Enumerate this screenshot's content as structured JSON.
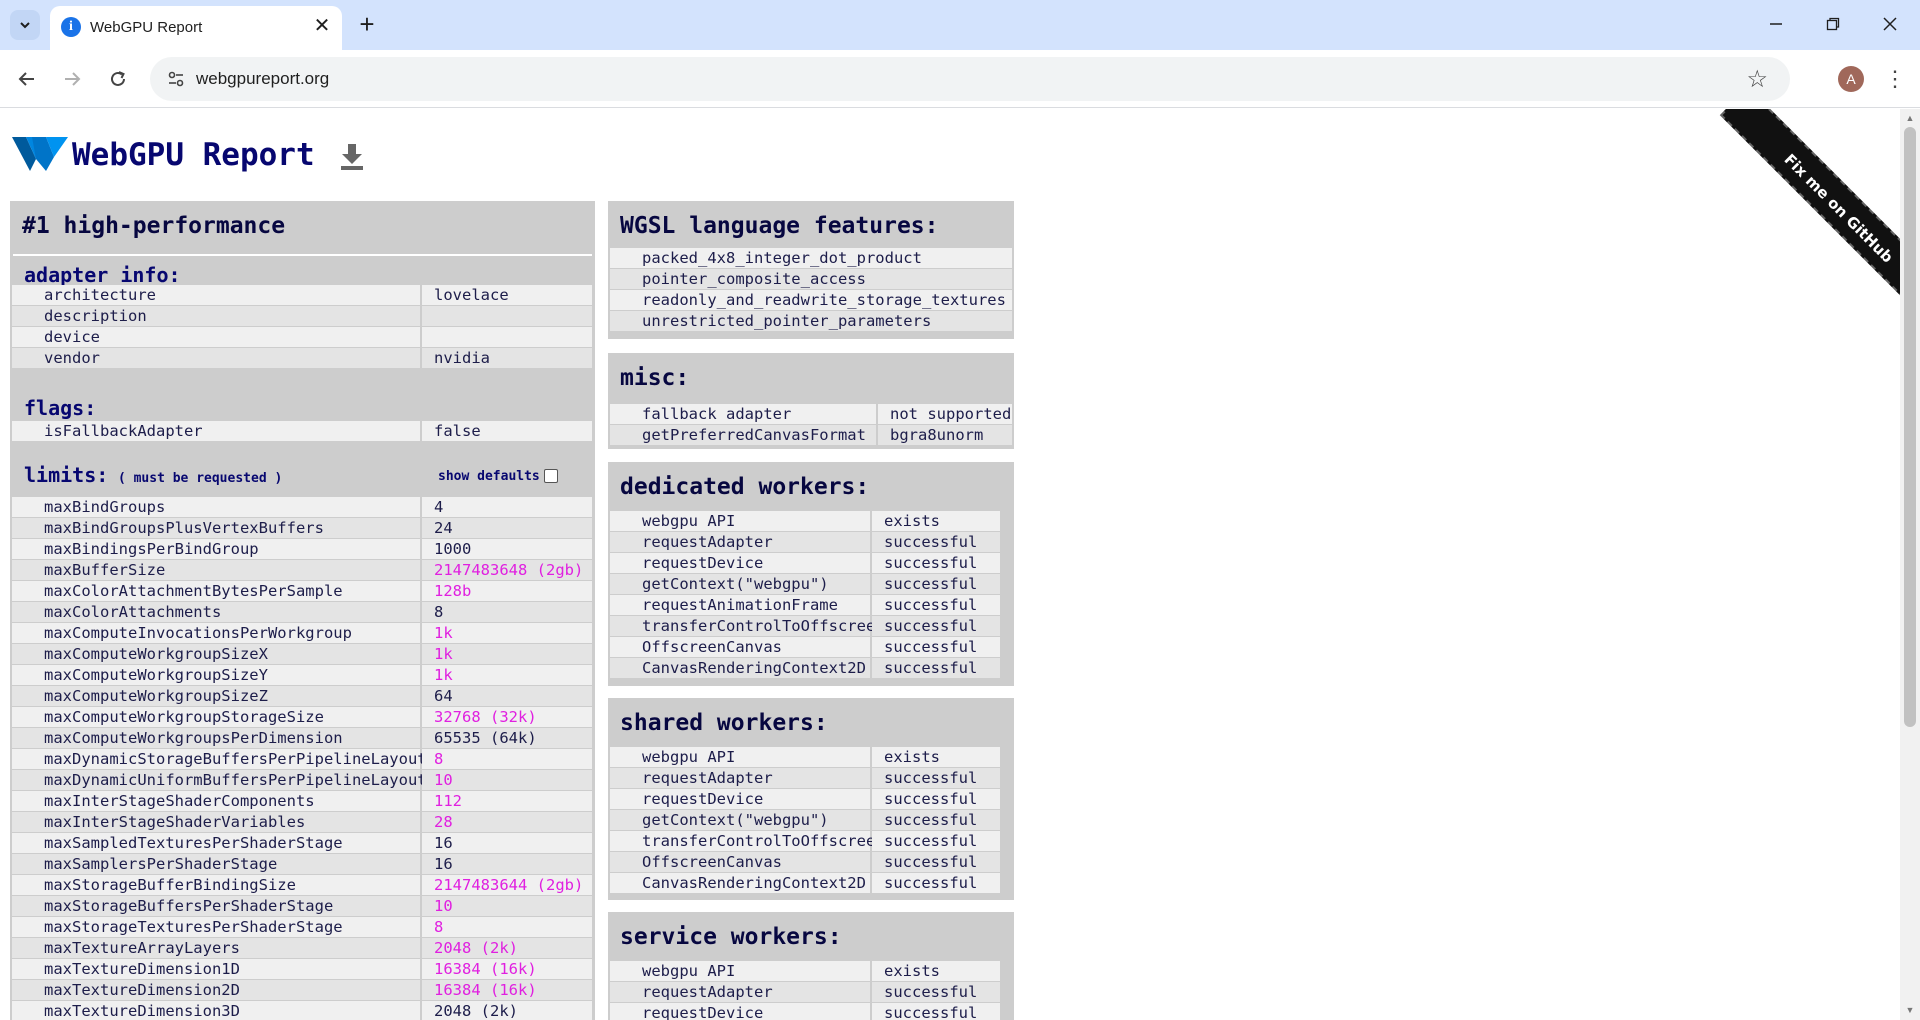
{
  "browser": {
    "tab_title": "WebGPU Report",
    "url": "webgpureport.org",
    "avatar_letter": "A"
  },
  "page": {
    "title": "WebGPU Report",
    "ribbon": "Fix me on GitHub"
  },
  "adapter": {
    "heading": "#1 high-performance",
    "info_heading": "adapter info:",
    "info": [
      {
        "k": "architecture",
        "v": "lovelace"
      },
      {
        "k": "description",
        "v": ""
      },
      {
        "k": "device",
        "v": ""
      },
      {
        "k": "vendor",
        "v": "nvidia"
      }
    ],
    "flags_heading": "flags:",
    "flags": [
      {
        "k": "isFallbackAdapter",
        "v": "false"
      }
    ],
    "limits_heading": "limits:",
    "limits_note": "( must be requested )",
    "show_defaults": "show defaults",
    "limits": [
      {
        "k": "maxBindGroups",
        "v": "4",
        "nd": false
      },
      {
        "k": "maxBindGroupsPlusVertexBuffers",
        "v": "24",
        "nd": false
      },
      {
        "k": "maxBindingsPerBindGroup",
        "v": "1000",
        "nd": false
      },
      {
        "k": "maxBufferSize",
        "v": "2147483648 (2gb)",
        "nd": true
      },
      {
        "k": "maxColorAttachmentBytesPerSample",
        "v": "128b",
        "nd": true
      },
      {
        "k": "maxColorAttachments",
        "v": "8",
        "nd": false
      },
      {
        "k": "maxComputeInvocationsPerWorkgroup",
        "v": "1k",
        "nd": true
      },
      {
        "k": "maxComputeWorkgroupSizeX",
        "v": "1k",
        "nd": true
      },
      {
        "k": "maxComputeWorkgroupSizeY",
        "v": "1k",
        "nd": true
      },
      {
        "k": "maxComputeWorkgroupSizeZ",
        "v": "64",
        "nd": false
      },
      {
        "k": "maxComputeWorkgroupStorageSize",
        "v": "32768 (32k)",
        "nd": true
      },
      {
        "k": "maxComputeWorkgroupsPerDimension",
        "v": "65535 (64k)",
        "nd": false
      },
      {
        "k": "maxDynamicStorageBuffersPerPipelineLayout",
        "v": "8",
        "nd": true
      },
      {
        "k": "maxDynamicUniformBuffersPerPipelineLayout",
        "v": "10",
        "nd": true
      },
      {
        "k": "maxInterStageShaderComponents",
        "v": "112",
        "nd": true
      },
      {
        "k": "maxInterStageShaderVariables",
        "v": "28",
        "nd": true
      },
      {
        "k": "maxSampledTexturesPerShaderStage",
        "v": "16",
        "nd": false
      },
      {
        "k": "maxSamplersPerShaderStage",
        "v": "16",
        "nd": false
      },
      {
        "k": "maxStorageBufferBindingSize",
        "v": "2147483644 (2gb)",
        "nd": true
      },
      {
        "k": "maxStorageBuffersPerShaderStage",
        "v": "10",
        "nd": true
      },
      {
        "k": "maxStorageTexturesPerShaderStage",
        "v": "8",
        "nd": true
      },
      {
        "k": "maxTextureArrayLayers",
        "v": "2048 (2k)",
        "nd": true
      },
      {
        "k": "maxTextureDimension1D",
        "v": "16384 (16k)",
        "nd": true
      },
      {
        "k": "maxTextureDimension2D",
        "v": "16384 (16k)",
        "nd": true
      },
      {
        "k": "maxTextureDimension3D",
        "v": "2048 (2k)",
        "nd": false
      }
    ]
  },
  "wgsl": {
    "heading": "WGSL language features:",
    "items": [
      "packed_4x8_integer_dot_product",
      "pointer_composite_access",
      "readonly_and_readwrite_storage_textures",
      "unrestricted_pointer_parameters"
    ]
  },
  "misc": {
    "heading": "misc:",
    "rows": [
      {
        "k": "fallback adapter",
        "v": "not supported"
      },
      {
        "k": "getPreferredCanvasFormat",
        "v": "bgra8unorm"
      }
    ]
  },
  "dedicated_workers": {
    "heading": "dedicated workers:",
    "rows": [
      {
        "k": "webgpu API",
        "v": "exists"
      },
      {
        "k": "requestAdapter",
        "v": "successful"
      },
      {
        "k": "requestDevice",
        "v": "successful"
      },
      {
        "k": "getContext(\"webgpu\")",
        "v": "successful"
      },
      {
        "k": "requestAnimationFrame",
        "v": "successful"
      },
      {
        "k": "transferControlToOffscreen",
        "v": "successful"
      },
      {
        "k": "OffscreenCanvas",
        "v": "successful"
      },
      {
        "k": "CanvasRenderingContext2D",
        "v": "successful"
      }
    ]
  },
  "shared_workers": {
    "heading": "shared workers:",
    "rows": [
      {
        "k": "webgpu API",
        "v": "exists"
      },
      {
        "k": "requestAdapter",
        "v": "successful"
      },
      {
        "k": "requestDevice",
        "v": "successful"
      },
      {
        "k": "getContext(\"webgpu\")",
        "v": "successful"
      },
      {
        "k": "transferControlToOffscreen",
        "v": "successful"
      },
      {
        "k": "OffscreenCanvas",
        "v": "successful"
      },
      {
        "k": "CanvasRenderingContext2D",
        "v": "successful"
      }
    ]
  },
  "service_workers": {
    "heading": "service workers:",
    "rows": [
      {
        "k": "webgpu API",
        "v": "exists"
      },
      {
        "k": "requestAdapter",
        "v": "successful"
      },
      {
        "k": "requestDevice",
        "v": "successful"
      }
    ]
  },
  "colors": {
    "heading_blue": "#070770",
    "non_default_value": "#e020e0",
    "panel_bg": "#cdcdcd"
  }
}
